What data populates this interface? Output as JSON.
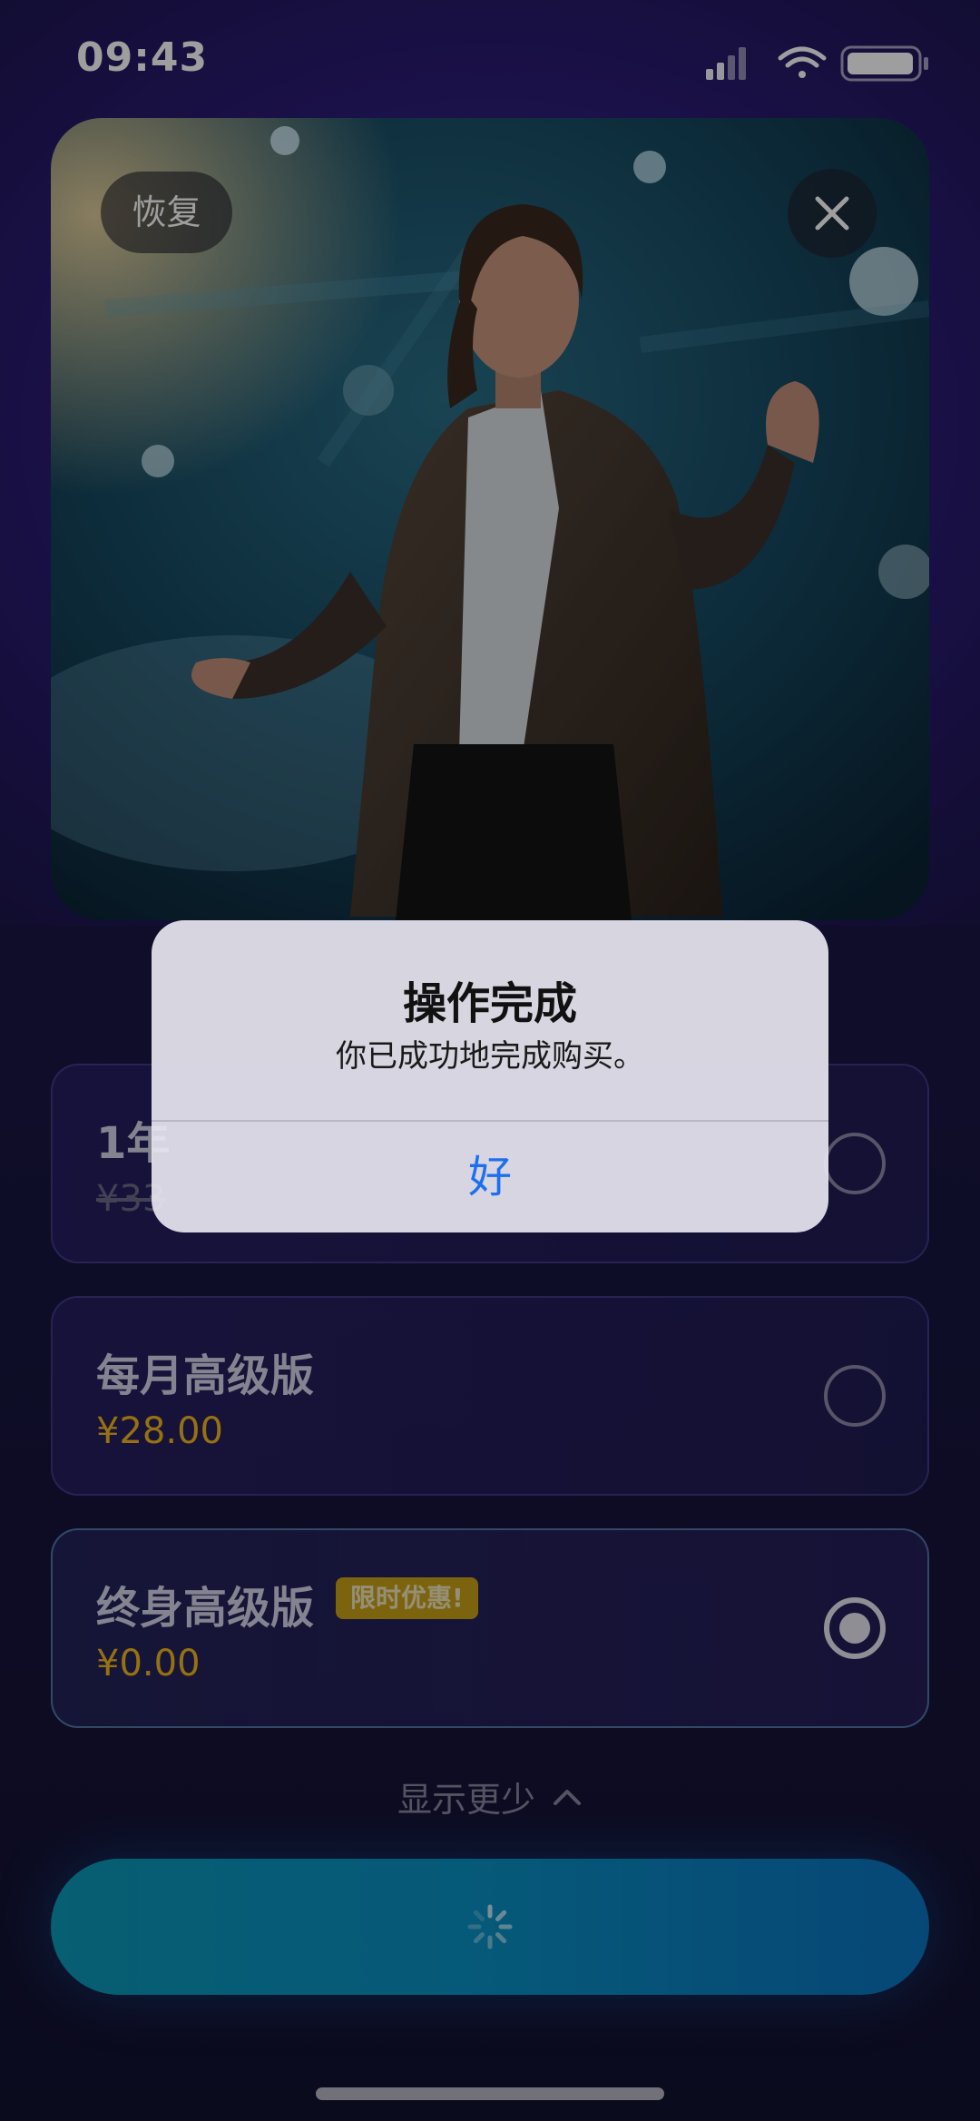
{
  "status_bar": {
    "time": "09:43",
    "icons": [
      "signal-icon",
      "wifi-icon",
      "battery-icon"
    ]
  },
  "header": {
    "restore_label": "恢复",
    "close_icon": "close-icon"
  },
  "plans": [
    {
      "title": "1年",
      "price": "¥33",
      "price_strikethrough": true,
      "selected": false
    },
    {
      "title": "每月高级版",
      "price": "¥28.00",
      "selected": false
    },
    {
      "title": "终身高级版",
      "badge": "限时优惠!",
      "price": "¥0.00",
      "selected": true
    }
  ],
  "show_less": {
    "label": "显示更少",
    "icon": "chevron-up-icon"
  },
  "cta": {
    "state_icon": "spinner-icon"
  },
  "alert": {
    "title": "操作完成",
    "message": "你已成功地完成购买。",
    "ok_label": "好"
  },
  "colors": {
    "accent_price": "#f2b61e",
    "cta_start": "#0c99b8",
    "cta_end": "#0a73bf",
    "alert_button": "#1e6ff0",
    "badge": "#c9a217"
  }
}
